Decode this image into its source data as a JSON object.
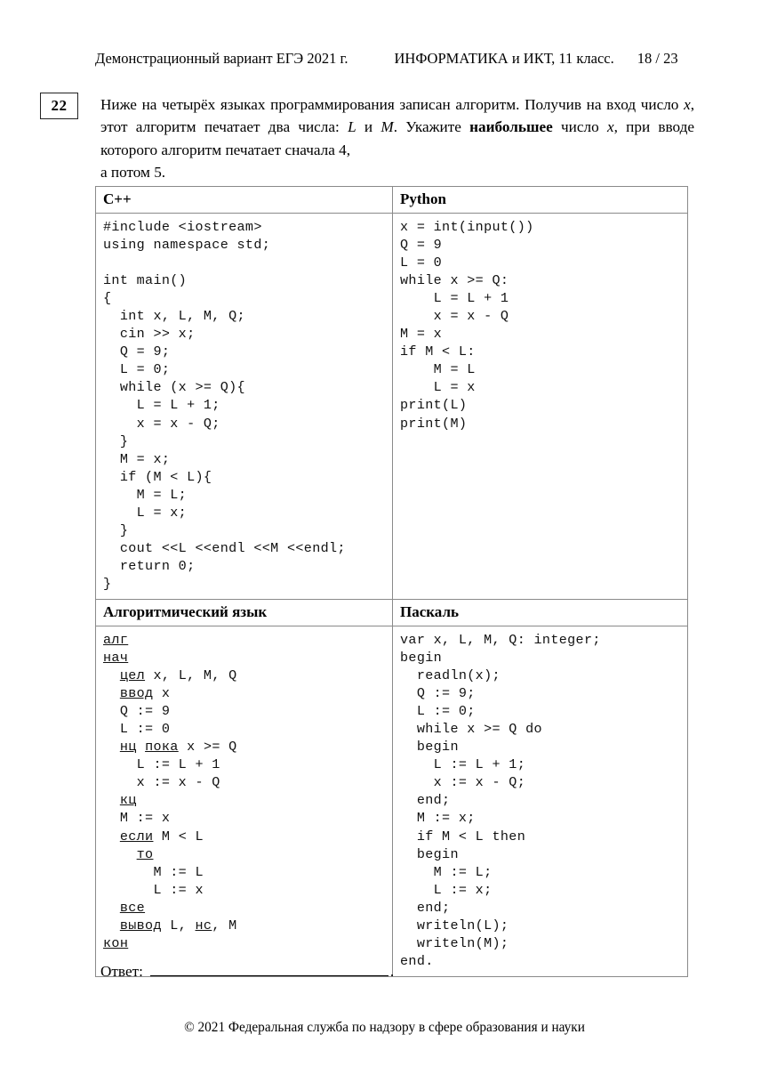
{
  "header": {
    "left": "Демонстрационный вариант ЕГЭ 2021 г.",
    "middle": "ИНФОРМАТИКА и ИКТ, 11 класс.",
    "page_indicator": "18 / 23"
  },
  "question": {
    "number": "22",
    "text_line1": "Ниже на четырёх языках программирования записан алгоритм. Получив",
    "text_line2_a": "на вход число ",
    "text_line2_x": "x",
    "text_line2_b": ", этот алгоритм печатает два числа: ",
    "text_line2_L": "L",
    "text_line2_c": " и ",
    "text_line2_M": "M",
    "text_line2_d": ". Укажите",
    "text_line3_bold": "наибольшее",
    "text_line3_a": " число ",
    "text_line3_x": "x",
    "text_line3_b": ", при вводе которого алгоритм печатает сначала 4,",
    "text_line4": "а потом 5."
  },
  "table": {
    "cpp": {
      "title": "C++",
      "code": "#include <iostream>\nusing namespace std;\n\nint main()\n{\n  int x, L, M, Q;\n  cin >> x;\n  Q = 9;\n  L = 0;\n  while (x >= Q){\n    L = L + 1;\n    x = x - Q;\n  }\n  M = x;\n  if (M < L){\n    M = L;\n    L = x;\n  }\n  cout <<L <<endl <<M <<endl;\n  return 0;\n}"
    },
    "python": {
      "title": "Python",
      "code": "x = int(input())\nQ = 9\nL = 0\nwhile x >= Q:\n    L = L + 1\n    x = x - Q\nM = x\nif M < L:\n    M = L\n    L = x\nprint(L)\nprint(M)"
    },
    "algo": {
      "title": "Алгоритмический язык",
      "lines": [
        {
          "indent": 0,
          "parts": [
            {
              "t": "алг",
              "u": true
            }
          ]
        },
        {
          "indent": 0,
          "parts": [
            {
              "t": "нач",
              "u": true
            }
          ]
        },
        {
          "indent": 2,
          "parts": [
            {
              "t": "цел",
              "u": true
            },
            {
              "t": " x, L, M, Q",
              "u": false
            }
          ]
        },
        {
          "indent": 2,
          "parts": [
            {
              "t": "ввод",
              "u": true
            },
            {
              "t": " x",
              "u": false
            }
          ]
        },
        {
          "indent": 2,
          "parts": [
            {
              "t": "Q := 9",
              "u": false
            }
          ]
        },
        {
          "indent": 2,
          "parts": [
            {
              "t": "L := 0",
              "u": false
            }
          ]
        },
        {
          "indent": 2,
          "parts": [
            {
              "t": "нц",
              "u": true
            },
            {
              "t": " ",
              "u": false
            },
            {
              "t": "пока",
              "u": true
            },
            {
              "t": " x >= Q",
              "u": false
            }
          ]
        },
        {
          "indent": 4,
          "parts": [
            {
              "t": "L := L + 1",
              "u": false
            }
          ]
        },
        {
          "indent": 4,
          "parts": [
            {
              "t": "x := x - Q",
              "u": false
            }
          ]
        },
        {
          "indent": 2,
          "parts": [
            {
              "t": "кц",
              "u": true
            }
          ]
        },
        {
          "indent": 2,
          "parts": [
            {
              "t": "M := x",
              "u": false
            }
          ]
        },
        {
          "indent": 2,
          "parts": [
            {
              "t": "если",
              "u": true
            },
            {
              "t": " M < L",
              "u": false
            }
          ]
        },
        {
          "indent": 4,
          "parts": [
            {
              "t": "то",
              "u": true
            }
          ]
        },
        {
          "indent": 6,
          "parts": [
            {
              "t": "M := L",
              "u": false
            }
          ]
        },
        {
          "indent": 6,
          "parts": [
            {
              "t": "L := x",
              "u": false
            }
          ]
        },
        {
          "indent": 2,
          "parts": [
            {
              "t": "все",
              "u": true
            }
          ]
        },
        {
          "indent": 2,
          "parts": [
            {
              "t": "вывод",
              "u": true
            },
            {
              "t": " L, ",
              "u": false
            },
            {
              "t": "нс",
              "u": true
            },
            {
              "t": ", M",
              "u": false
            }
          ]
        },
        {
          "indent": 0,
          "parts": [
            {
              "t": "кон",
              "u": true
            }
          ]
        }
      ]
    },
    "pascal": {
      "title": "Паскаль",
      "code": "var x, L, M, Q: integer;\nbegin\n  readln(x);\n  Q := 9;\n  L := 0;\n  while x >= Q do\n  begin\n    L := L + 1;\n    x := x - Q;\n  end;\n  M := x;\n  if M < L then\n  begin\n    M := L;\n    L := x;\n  end;\n  writeln(L);\n  writeln(M);\nend."
    }
  },
  "answer": {
    "label": "Ответ:",
    "value": "",
    "trailing_dot": "."
  },
  "footer": {
    "text": "© 2021 Федеральная служба по надзору в сфере образования и науки"
  }
}
